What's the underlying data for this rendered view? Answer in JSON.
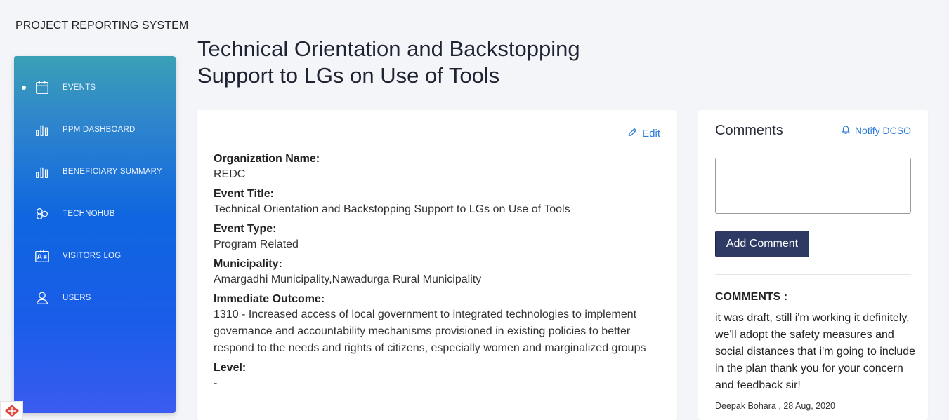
{
  "app": {
    "title": "PROJECT REPORTING SYSTEM"
  },
  "sidebar": {
    "items": [
      {
        "label": "EVENTS",
        "icon": "calendar-icon",
        "active": true
      },
      {
        "label": "PPM DASHBOARD",
        "icon": "bar-chart-icon",
        "active": false
      },
      {
        "label": "BENEFICIARY SUMMARY",
        "icon": "bar-chart-icon",
        "active": false
      },
      {
        "label": "TECHNOHUB",
        "icon": "hub-icon",
        "active": false
      },
      {
        "label": "VISITORS LOG",
        "icon": "id-card-icon",
        "active": false
      },
      {
        "label": "USERS",
        "icon": "user-icon",
        "active": false
      }
    ]
  },
  "page": {
    "title": "Technical Orientation and Backstopping Support to LGs on Use of Tools"
  },
  "event": {
    "edit_label": "Edit",
    "fields": [
      {
        "label": "Organization Name:",
        "value": "REDC"
      },
      {
        "label": "Event Title:",
        "value": "Technical Orientation and Backstopping Support to LGs on Use of Tools"
      },
      {
        "label": "Event Type:",
        "value": "Program Related"
      },
      {
        "label": "Municipality:",
        "value": "Amargadhi Municipality,Nawadurga Rural Municipality"
      },
      {
        "label": "Immediate Outcome:",
        "value": "1310 - Increased access of local government to integrated technologies to implement governance and accountability mechanisms provisioned in existing policies to better respond to the needs and rights of citizens, especially women and marginalized groups"
      },
      {
        "label": "Level:",
        "value": "-"
      }
    ]
  },
  "comments": {
    "heading": "Comments",
    "notify_label": "Notify DCSO",
    "input_value": "",
    "add_button_label": "Add Comment",
    "list_title": "COMMENTS :",
    "items": [
      {
        "text": "it was draft, still i'm working it definitely, we'll adopt the safety measures and social distances that i'm going to include in the plan thank you for your concern and feedback sir!",
        "author": "Deepak Bohara",
        "separator": ",",
        "date": "28 Aug, 2020"
      }
    ]
  },
  "colors": {
    "accent_link": "#2b7bd8",
    "button_bg": "#2e3a64",
    "sidebar_gradient_top": "#3aa0b6",
    "sidebar_gradient_bottom": "#3b5bf0",
    "page_bg": "#f4f5f9"
  }
}
